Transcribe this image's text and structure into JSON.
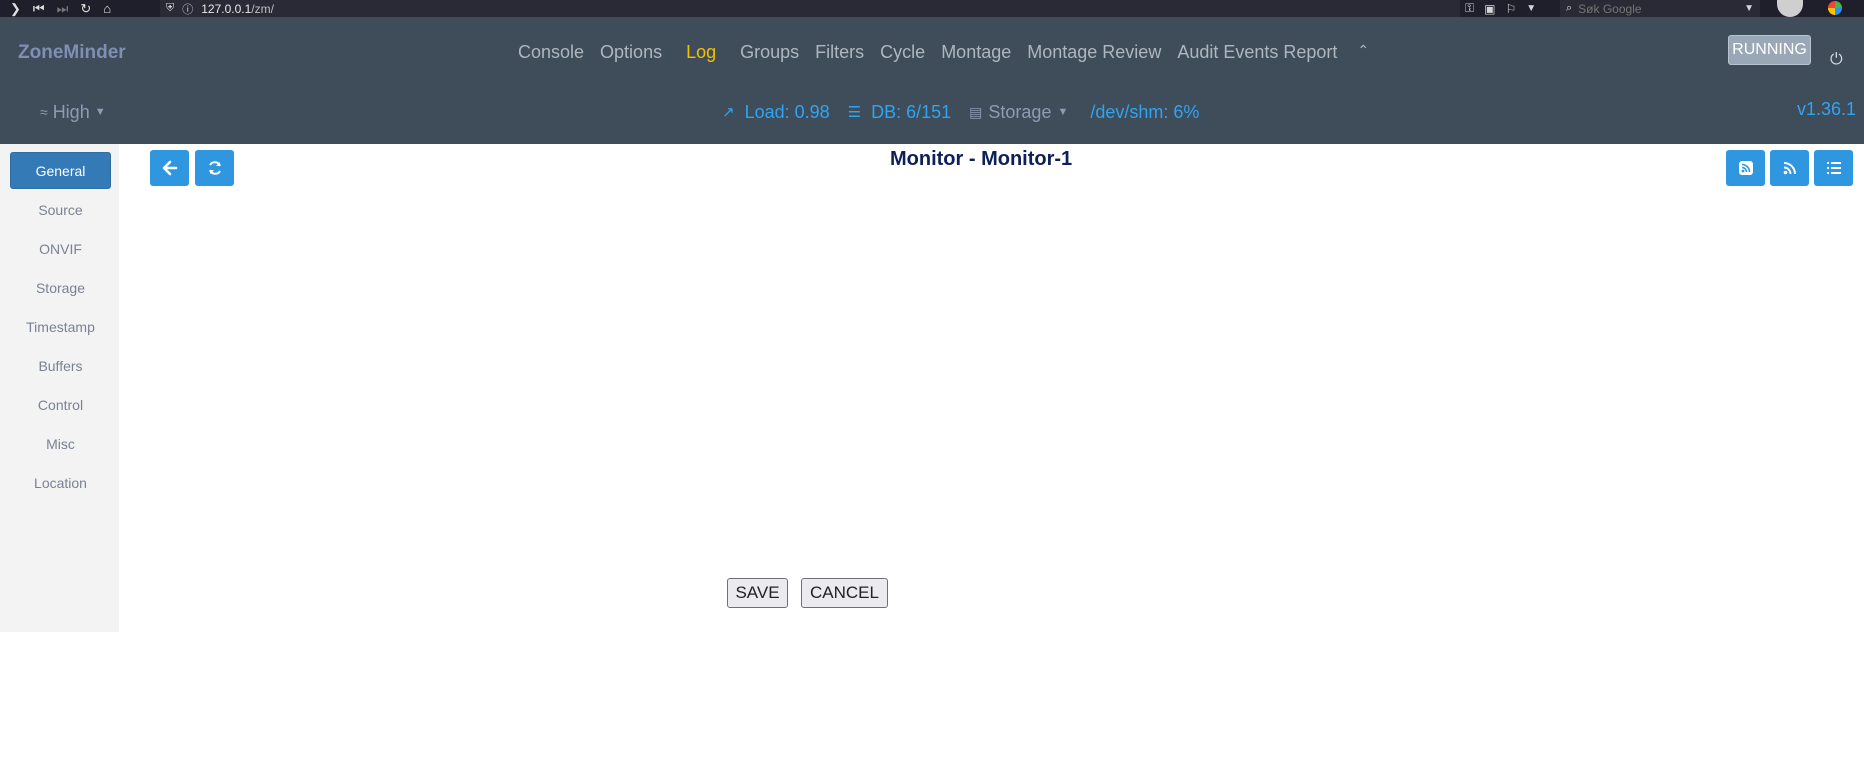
{
  "browser": {
    "url_host": "127.0.0.1",
    "url_path": "/zm/",
    "search_placeholder": "Søk Google"
  },
  "header": {
    "brand": "ZoneMinder",
    "nav": [
      "Console",
      "Options",
      "Log",
      "Groups",
      "Filters",
      "Cycle",
      "Montage",
      "Montage Review",
      "Audit Events Report"
    ],
    "active_nav": "Log",
    "status": "RUNNING",
    "bandwidth": "High",
    "load": "Load: 0.98",
    "db": "DB: 6/151",
    "storage": "Storage",
    "shm": "/dev/shm: 6%",
    "version": "v1.36.1"
  },
  "sidebar": {
    "items": [
      "General",
      "Source",
      "ONVIF",
      "Storage",
      "Timestamp",
      "Buffers",
      "Control",
      "Misc",
      "Location"
    ],
    "active": "General"
  },
  "page": {
    "title": "Monitor - Monitor-1",
    "save_label": "SAVE",
    "cancel_label": "CANCEL"
  },
  "icons": {
    "back": "arrow-left-icon",
    "refresh": "refresh-icon",
    "rss1": "rss-square-icon",
    "rss2": "rss-icon",
    "list": "list-icon"
  },
  "colors": {
    "header_bg": "#3f4c59",
    "accent": "#2f96e0",
    "active_nav": "#f2c200",
    "sidebar_active": "#337ab7"
  }
}
